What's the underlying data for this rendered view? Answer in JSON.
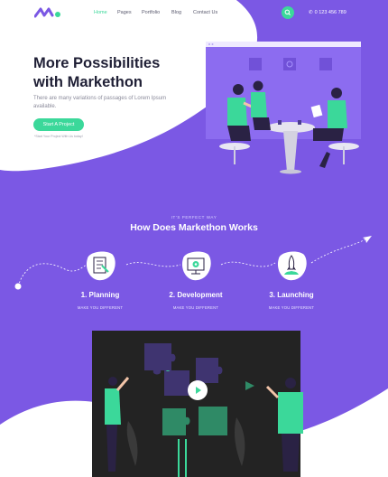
{
  "nav": {
    "links": [
      {
        "label": "Home"
      },
      {
        "label": "Pages"
      },
      {
        "label": "Portfolio"
      },
      {
        "label": "Blog"
      },
      {
        "label": "Contact Us"
      }
    ],
    "phone": "0 123 456 789"
  },
  "hero": {
    "title_line1": "More Possibilities",
    "title_line2": "with Markethon",
    "subtitle": "There are many variations of passages of Lorem Ipsum available.",
    "cta_label": "Start A Project",
    "cta_note": "*Start Your Project With Us today!"
  },
  "how": {
    "kicker": "IT'S PERFECT WAY",
    "title": "How Does Markethon Works",
    "steps": [
      {
        "title": "1. Planning",
        "subtitle": "MAKE YOU DIFFERENT",
        "icon": "checklist-icon"
      },
      {
        "title": "2. Development",
        "subtitle": "MAKE YOU DIFFERENT",
        "icon": "settings-monitor-icon"
      },
      {
        "title": "3. Launching",
        "subtitle": "MAKE YOU DIFFERENT",
        "icon": "rocket-icon"
      }
    ]
  },
  "colors": {
    "accent_green": "#3bd89a",
    "brand_purple": "#7c5ae6",
    "dark_text": "#1f1f35"
  }
}
